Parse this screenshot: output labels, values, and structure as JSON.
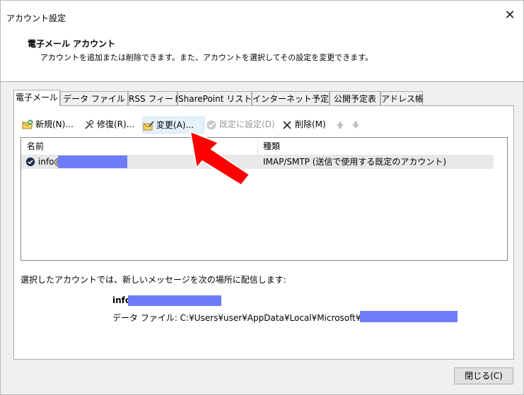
{
  "window": {
    "title": "アカウント設定"
  },
  "header": {
    "title": "電子メール アカウント",
    "description": "アカウントを追加または削除できます。また、アカウントを選択してその設定を変更できます。"
  },
  "tabs": [
    {
      "label": "電子メール"
    },
    {
      "label": "データ ファイル"
    },
    {
      "label": "RSS フィード"
    },
    {
      "label": "SharePoint リスト"
    },
    {
      "label": "インターネット予定表"
    },
    {
      "label": "公開予定表"
    },
    {
      "label": "アドレス帳"
    }
  ],
  "toolbar": {
    "new_label": "新規(N)...",
    "repair_label": "修復(R)...",
    "change_label": "変更(A)...",
    "default_label": "既定に設定(D)",
    "delete_label": "削除(M)"
  },
  "list": {
    "columns": [
      "名前",
      "種類"
    ],
    "rows": [
      {
        "name": "info@",
        "type": "IMAP/SMTP (送信で使用する既定のアカウント)"
      }
    ]
  },
  "deliver": {
    "text": "選択したアカウントでは、新しいメッセージを次の場所に配信します:",
    "account": "info@",
    "file_path": "データ ファイル: C:¥Users¥user¥AppData¥Local¥Microsoft¥Outlo"
  },
  "footer": {
    "close_label": "閉じる(C)"
  },
  "colors": {
    "redaction": "#6f7cf9",
    "annotation_arrow": "#ff0000"
  }
}
